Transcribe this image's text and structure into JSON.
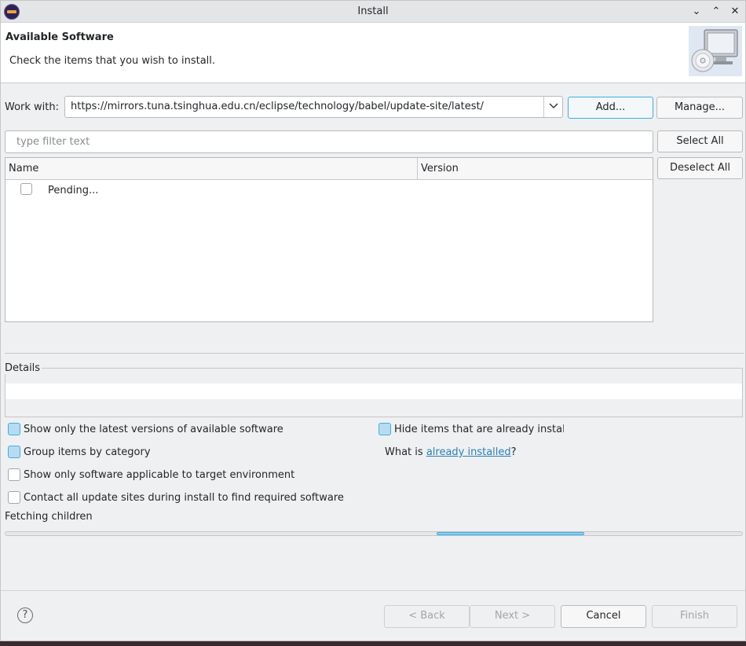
{
  "window": {
    "title": "Install",
    "controls": {
      "minimize": "⌄",
      "maximize": "⌃",
      "close": "✕"
    }
  },
  "header": {
    "title": "Available Software",
    "description": "Check the items that you wish to install."
  },
  "work_with": {
    "label": "Work with:",
    "value": "https://mirrors.tuna.tsinghua.edu.cn/eclipse/technology/babel/update-site/latest/",
    "add_label": "Add...",
    "manage_label": "Manage..."
  },
  "filter": {
    "placeholder": "type filter text"
  },
  "side_buttons": {
    "select_all": "Select All",
    "deselect_all": "Deselect All"
  },
  "table": {
    "columns": [
      "Name",
      "Version"
    ],
    "rows": [
      {
        "name": "Pending...",
        "version": "",
        "checked": false
      }
    ]
  },
  "details": {
    "label": "Details"
  },
  "options": {
    "latest_versions": {
      "label": "Show only the latest versions of available software",
      "checked": true
    },
    "group_by_category": {
      "label": "Group items by category",
      "checked": true
    },
    "applicable_only": {
      "label": "Show only software applicable to target environment",
      "checked": false
    },
    "contact_all_sites": {
      "label": "Contact all update sites during install to find required software",
      "checked": false
    },
    "hide_installed": {
      "label": "Hide items that are already installed",
      "checked": true
    },
    "what_is_prefix": "What is ",
    "what_is_link": "already installed",
    "what_is_suffix": "?"
  },
  "status": {
    "text": "Fetching children",
    "progress_start_fraction": 0.585,
    "progress_end_fraction": 0.785
  },
  "footer": {
    "help_glyph": "?",
    "back_label": "< Back",
    "next_label": "Next >",
    "cancel_label": "Cancel",
    "finish_label": "Finish"
  },
  "colors": {
    "accent": "#3daee9",
    "link": "#2980b9",
    "checked_fill": "#b7dcf1"
  }
}
